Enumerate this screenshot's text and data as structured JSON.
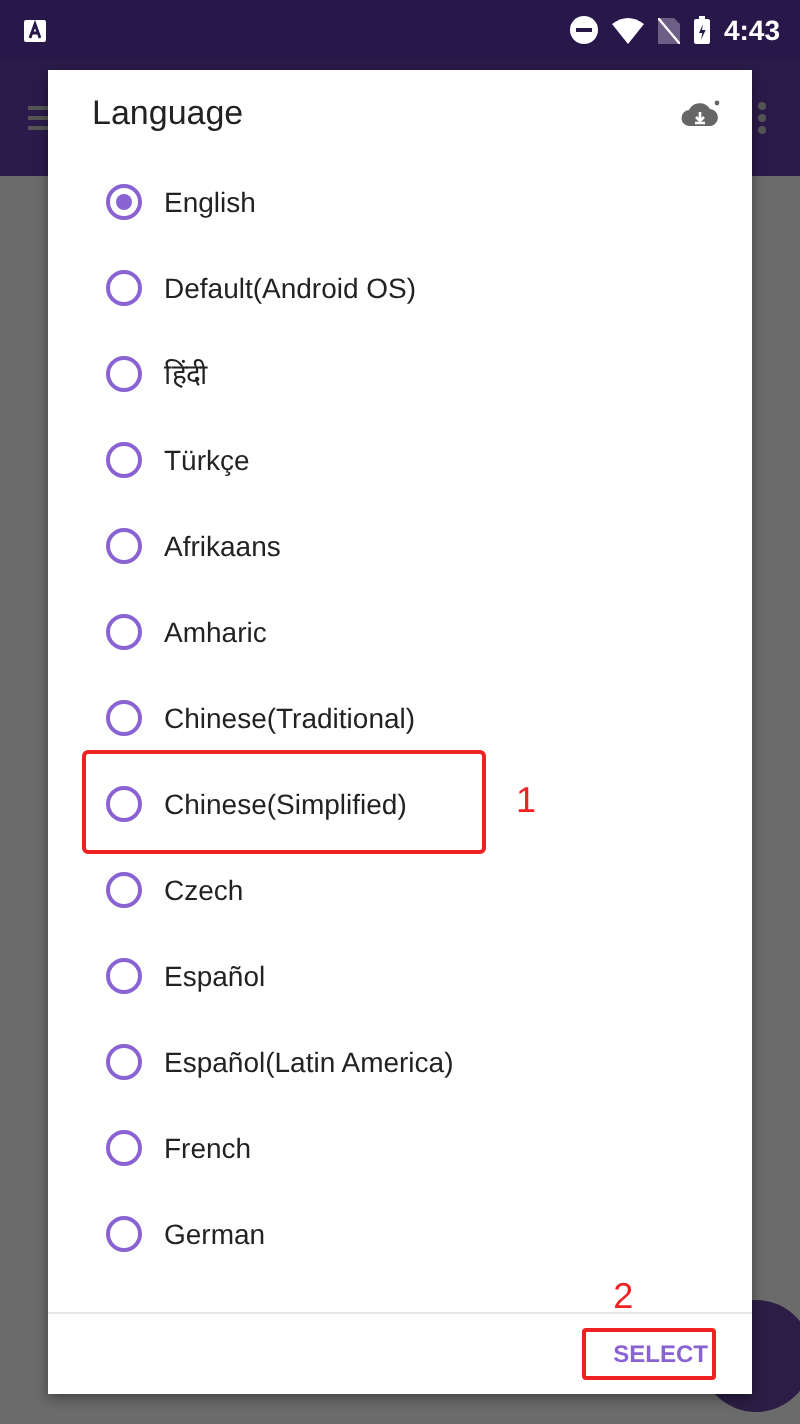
{
  "status_bar": {
    "time": "4:43"
  },
  "dialog": {
    "title": "Language",
    "options": [
      {
        "label": "English",
        "selected": true
      },
      {
        "label": "Default(Android OS)",
        "selected": false
      },
      {
        "label": "हिंदी",
        "selected": false
      },
      {
        "label": "Türkçe",
        "selected": false
      },
      {
        "label": "Afrikaans",
        "selected": false
      },
      {
        "label": "Amharic",
        "selected": false
      },
      {
        "label": "Chinese(Traditional)",
        "selected": false
      },
      {
        "label": "Chinese(Simplified)",
        "selected": false,
        "annotation": "1"
      },
      {
        "label": "Czech",
        "selected": false
      },
      {
        "label": "Español",
        "selected": false
      },
      {
        "label": "Español(Latin America)",
        "selected": false
      },
      {
        "label": "French",
        "selected": false
      },
      {
        "label": "German",
        "selected": false
      }
    ],
    "button": {
      "label": "SELECT",
      "annotation": "2"
    }
  }
}
